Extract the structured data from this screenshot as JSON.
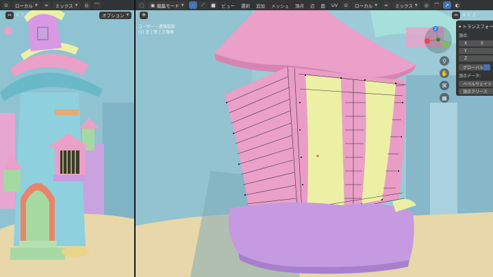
{
  "left_viewport": {
    "header": {
      "orientation": "ローカル",
      "shading": "ミックス",
      "options": "オプション"
    },
    "axis": {
      "x": "X",
      "y": "Y",
      "z": "Z"
    }
  },
  "right_viewport": {
    "header": {
      "mode": "編集モード",
      "menus": [
        "ビュー",
        "選択",
        "追加",
        "メッシュ",
        "頂点",
        "辺",
        "面",
        "UV"
      ],
      "orientation": "ローカル",
      "shading": "ミックス"
    },
    "axis": {
      "x": "X",
      "y": "Y",
      "z": "Z"
    },
    "overlay_info": [
      "ユーザー・透視投影",
      "(1) 芝 | 窓 | 三角面"
    ],
    "gizmo_axes": {
      "z": "Z",
      "x": "X",
      "y": "Y"
    },
    "n_panel": {
      "title": "トランスフォーム",
      "vertex_label": "頂点:",
      "x_label": "X",
      "x_value": "0",
      "y_label": "Y",
      "z_label": "Z",
      "global_label": "グローバル",
      "vertex_data_label": "頂点データ:",
      "bevel_weight": "ベベルウェイト",
      "vertex_crease": "頂点クリース"
    }
  },
  "colors": {
    "sky": "#9ccad6",
    "pink": "#eaa0c8",
    "yellow": "#ecf0a5",
    "purple": "#c89de0",
    "sand": "#e8d7a8",
    "accent": "#4772b3"
  }
}
